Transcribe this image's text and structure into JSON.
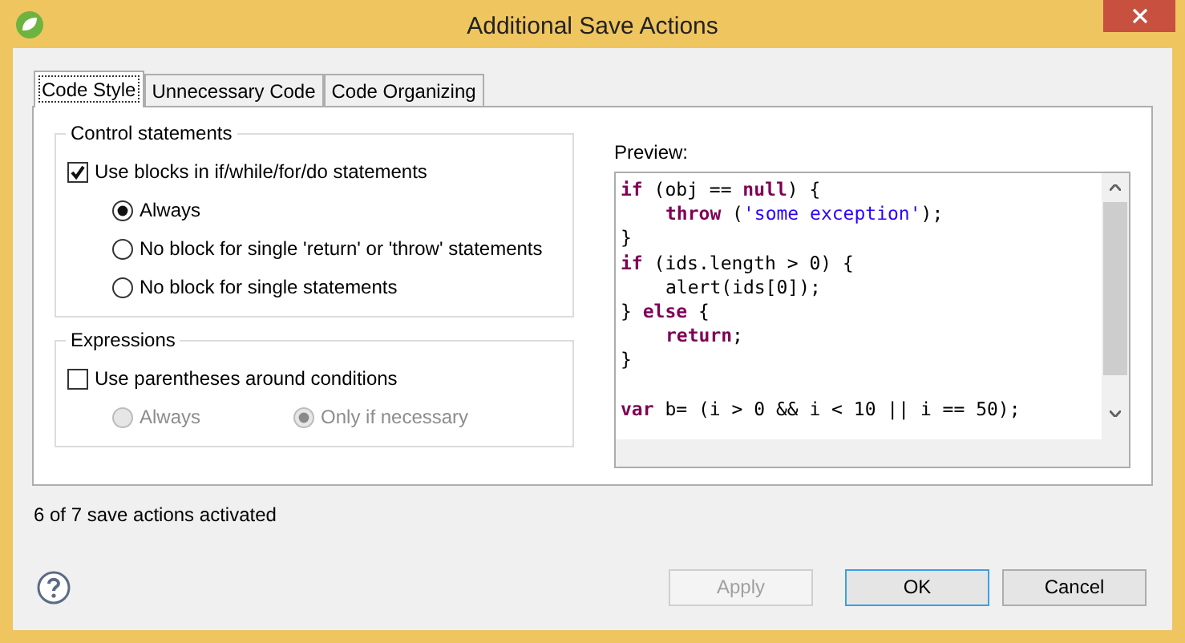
{
  "window": {
    "title": "Additional Save Actions"
  },
  "tabs": [
    {
      "label": "Code Style",
      "selected": true
    },
    {
      "label": "Unnecessary Code",
      "selected": false
    },
    {
      "label": "Code Organizing",
      "selected": false
    }
  ],
  "groups": [
    {
      "title": "Control statements",
      "checkbox": {
        "label": "Use blocks in if/while/for/do statements",
        "checked": true
      },
      "options_inline": false,
      "options": [
        {
          "label": "Always",
          "selected": true,
          "disabled": false
        },
        {
          "label": "No block for single 'return' or 'throw' statements",
          "selected": false,
          "disabled": false
        },
        {
          "label": "No block for single statements",
          "selected": false,
          "disabled": false
        }
      ]
    },
    {
      "title": "Expressions",
      "checkbox": {
        "label": "Use parentheses around conditions",
        "checked": false
      },
      "options_inline": true,
      "options": [
        {
          "label": "Always",
          "selected": false,
          "disabled": true
        },
        {
          "label": "Only if necessary",
          "selected": true,
          "disabled": true
        }
      ]
    }
  ],
  "preview": {
    "label": "Preview:",
    "lines": [
      {
        "indented": false,
        "gap_before": false,
        "tokens": [
          {
            "kind": "keyword",
            "text": "if"
          },
          {
            "kind": "plain",
            "text": " (obj == "
          },
          {
            "kind": "keyword",
            "text": "null"
          },
          {
            "kind": "plain",
            "text": ") {"
          }
        ]
      },
      {
        "indented": true,
        "gap_before": false,
        "tokens": [
          {
            "kind": "keyword",
            "text": "throw"
          },
          {
            "kind": "plain",
            "text": " ("
          },
          {
            "kind": "string",
            "text": "'some exception'"
          },
          {
            "kind": "plain",
            "text": ");"
          }
        ]
      },
      {
        "indented": false,
        "gap_before": false,
        "tokens": [
          {
            "kind": "plain",
            "text": "}"
          }
        ]
      },
      {
        "indented": false,
        "gap_before": false,
        "tokens": [
          {
            "kind": "keyword",
            "text": "if"
          },
          {
            "kind": "plain",
            "text": " (ids.length > 0) {"
          }
        ]
      },
      {
        "indented": true,
        "gap_before": false,
        "tokens": [
          {
            "kind": "plain",
            "text": "alert(ids[0]);"
          }
        ]
      },
      {
        "indented": false,
        "gap_before": false,
        "tokens": [
          {
            "kind": "plain",
            "text": "} "
          },
          {
            "kind": "keyword",
            "text": "else"
          },
          {
            "kind": "plain",
            "text": " {"
          }
        ]
      },
      {
        "indented": true,
        "gap_before": false,
        "tokens": [
          {
            "kind": "keyword",
            "text": "return"
          },
          {
            "kind": "plain",
            "text": ";"
          }
        ]
      },
      {
        "indented": false,
        "gap_before": false,
        "tokens": [
          {
            "kind": "plain",
            "text": "}"
          }
        ]
      },
      {
        "indented": false,
        "gap_before": true,
        "tokens": [
          {
            "kind": "keyword",
            "text": "var"
          },
          {
            "kind": "plain",
            "text": " b= (i > 0 && i < 10 || i == 50);"
          }
        ]
      }
    ]
  },
  "status": "6 of 7 save actions activated",
  "buttons": [
    {
      "label": "Apply",
      "disabled": true,
      "default": false
    },
    {
      "label": "OK",
      "disabled": false,
      "default": true
    },
    {
      "label": "Cancel",
      "disabled": false,
      "default": false
    }
  ]
}
